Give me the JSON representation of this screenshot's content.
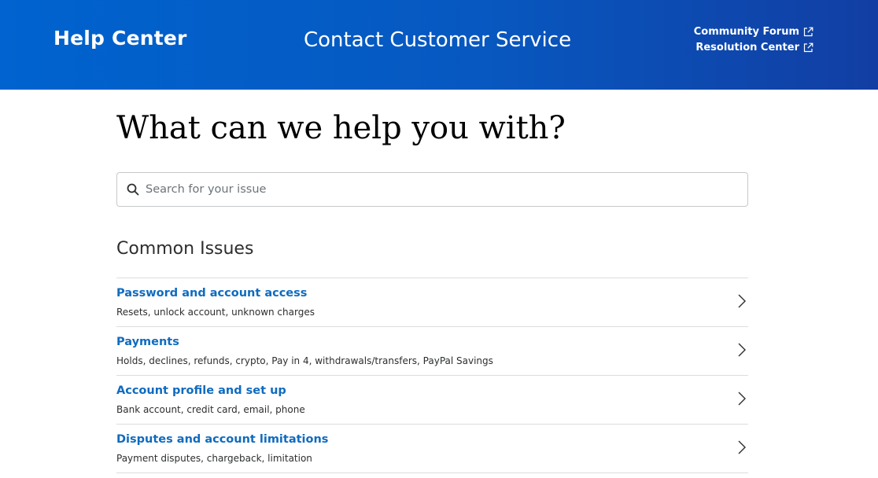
{
  "header": {
    "brand": "Help Center",
    "contact": "Contact Customer Service",
    "links": [
      {
        "label": "Community Forum",
        "icon": "external-link-icon"
      },
      {
        "label": "Resolution Center",
        "icon": "external-link-icon"
      }
    ]
  },
  "main": {
    "title": "What can we help you with?",
    "search": {
      "placeholder": "Search for your issue",
      "value": "",
      "icon": "search-icon"
    },
    "section_title": "Common Issues",
    "issues": [
      {
        "title": "Password and account access",
        "desc": "Resets, unlock account, unknown charges"
      },
      {
        "title": "Payments",
        "desc": "Holds, declines, refunds, crypto, Pay in 4, withdrawals/transfers, PayPal Savings"
      },
      {
        "title": "Account profile and set up",
        "desc": "Bank account, credit card, email, phone"
      },
      {
        "title": "Disputes and account limitations",
        "desc": "Payment disputes, chargeback, limitation"
      }
    ]
  },
  "colors": {
    "header_start": "#0063cf",
    "header_end": "#123ea3",
    "link_blue": "#0f6bbf",
    "divider": "#dcdddf"
  }
}
